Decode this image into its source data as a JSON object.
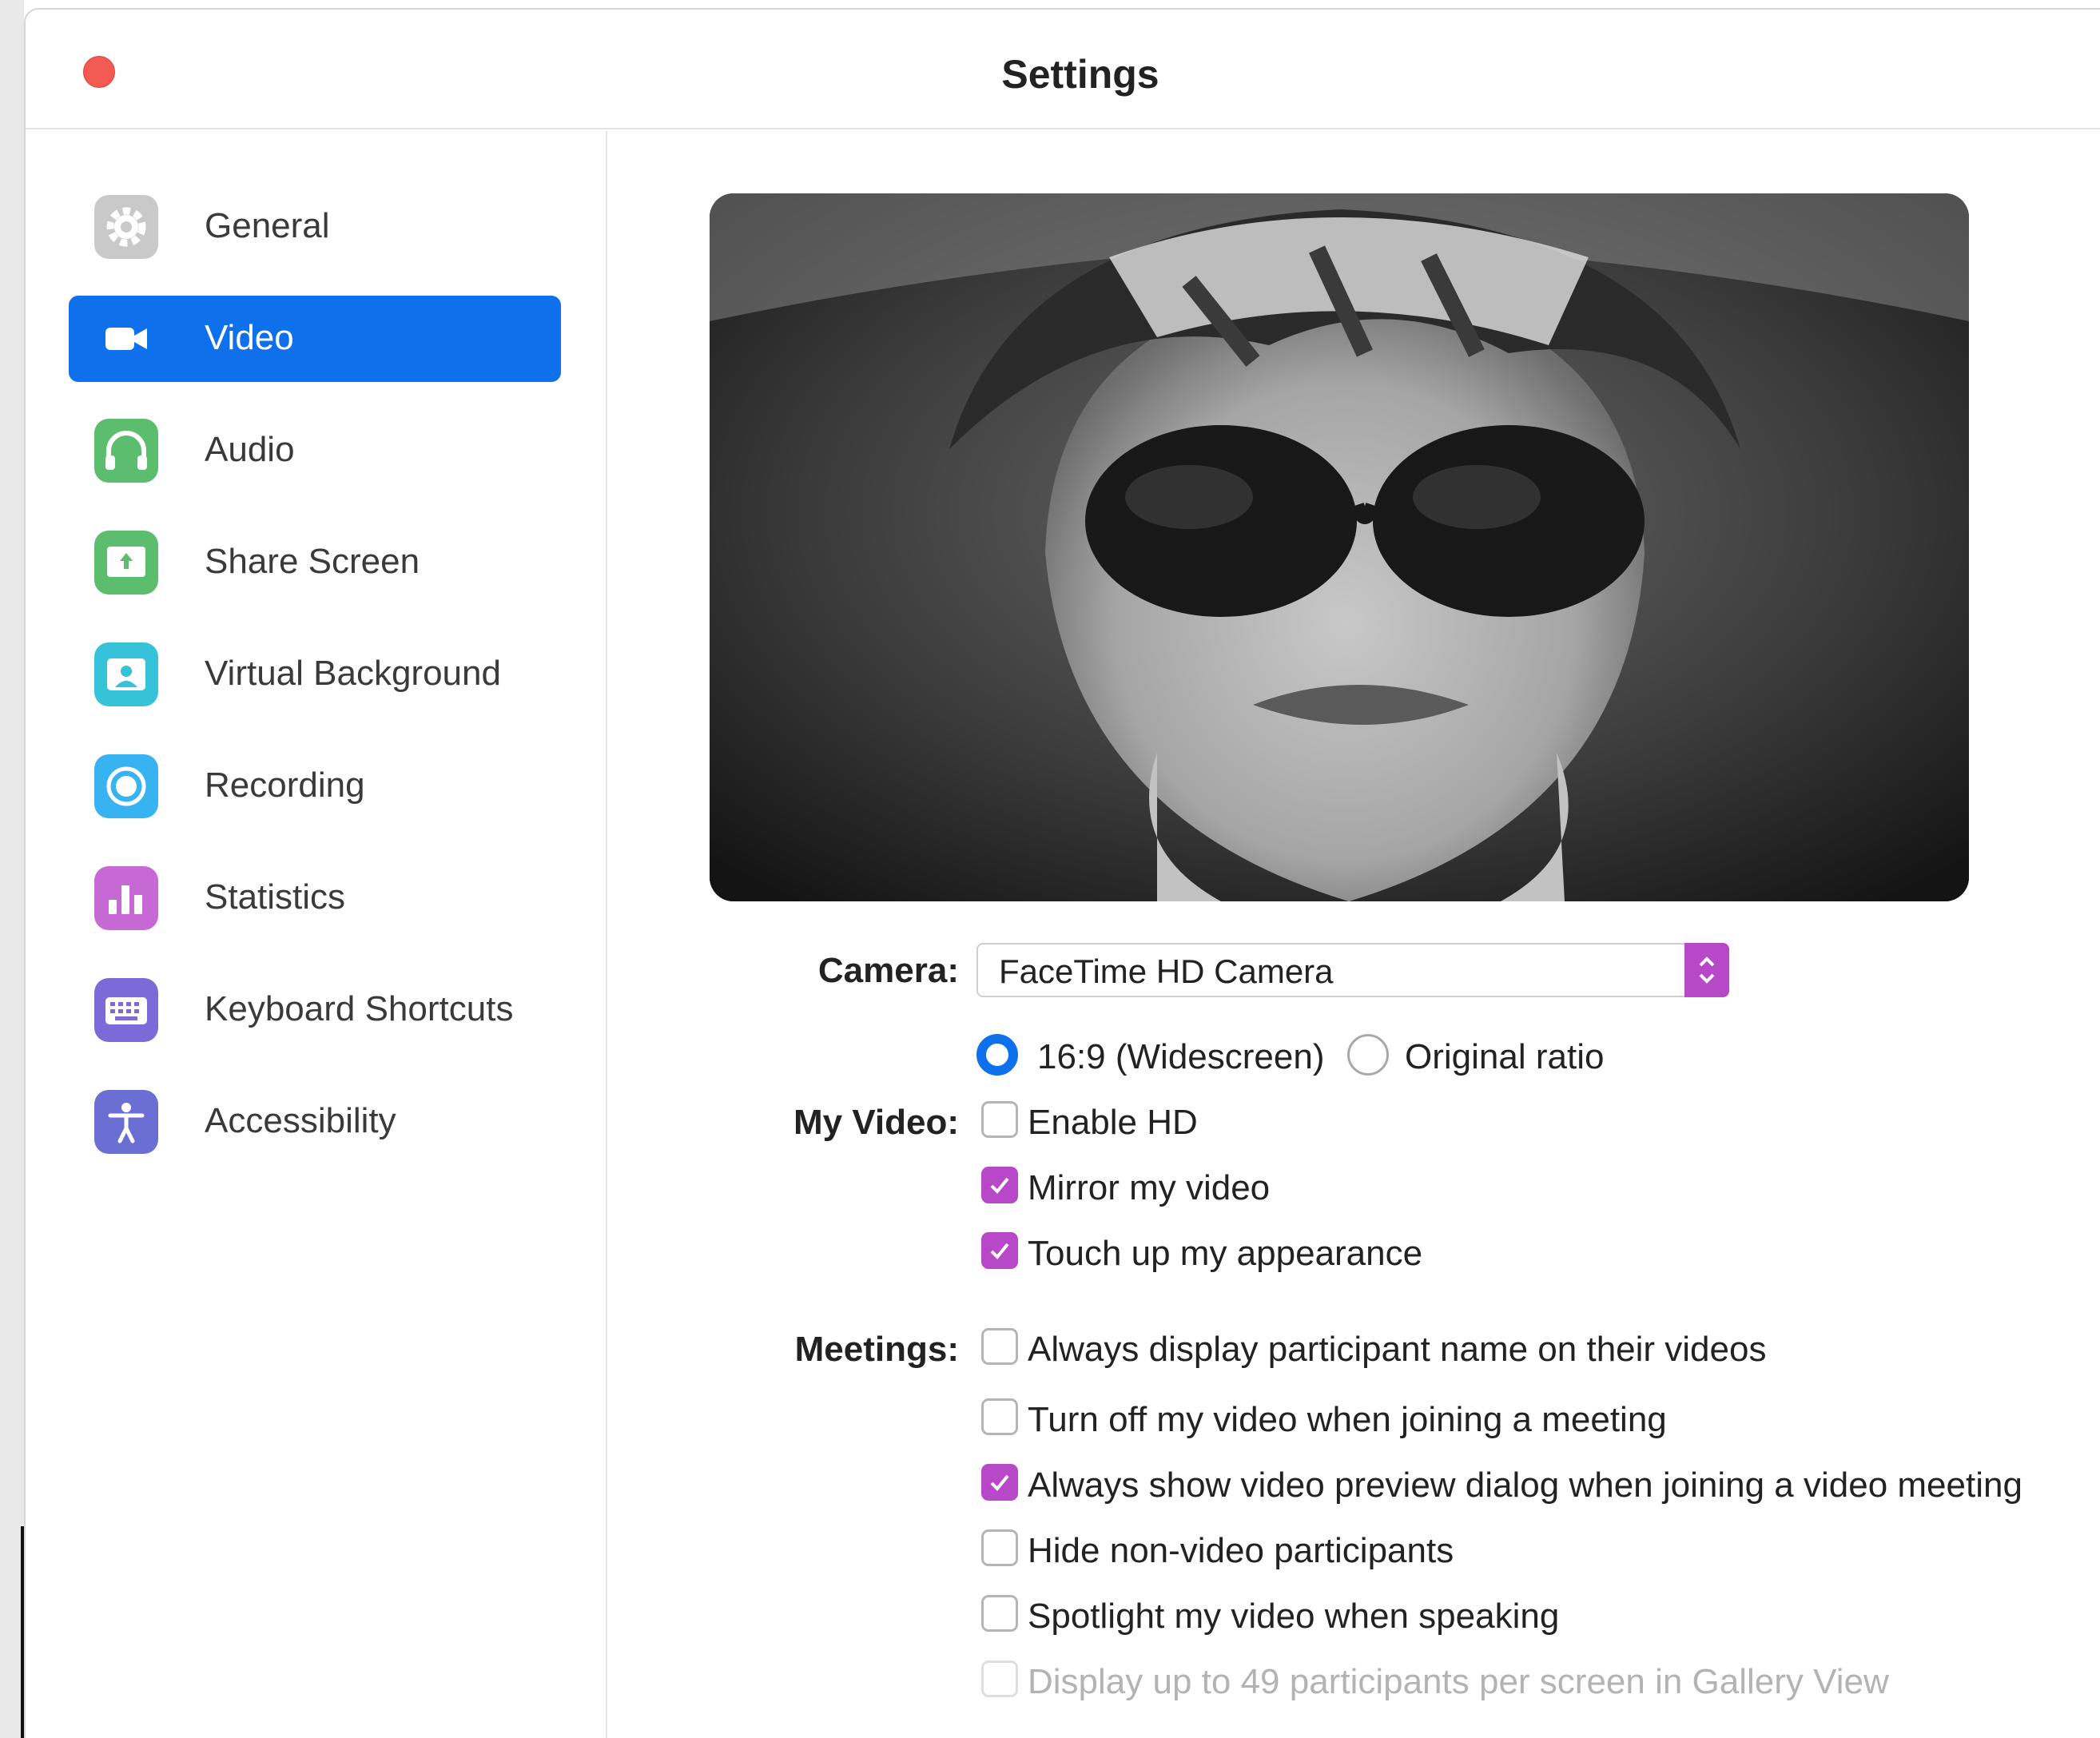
{
  "window": {
    "title": "Settings"
  },
  "sidebar": {
    "items": [
      {
        "label": "General",
        "icon": "gear-icon",
        "color": "#c9c9c9",
        "active": false
      },
      {
        "label": "Video",
        "icon": "video-camera-icon",
        "color": "#0e71eb",
        "active": true
      },
      {
        "label": "Audio",
        "icon": "headphones-icon",
        "color": "#5dbd6e",
        "active": false
      },
      {
        "label": "Share Screen",
        "icon": "share-screen-icon",
        "color": "#5dbd6e",
        "active": false
      },
      {
        "label": "Virtual Background",
        "icon": "person-frame-icon",
        "color": "#36c2d8",
        "active": false
      },
      {
        "label": "Recording",
        "icon": "record-icon",
        "color": "#38b3f2",
        "active": false
      },
      {
        "label": "Statistics",
        "icon": "bar-chart-icon",
        "color": "#c769d4",
        "active": false
      },
      {
        "label": "Keyboard Shortcuts",
        "icon": "keyboard-icon",
        "color": "#7b6ad8",
        "active": false
      },
      {
        "label": "Accessibility",
        "icon": "accessibility-icon",
        "color": "#6b6fd3",
        "active": false
      }
    ]
  },
  "video": {
    "camera_label": "Camera:",
    "camera_value": "FaceTime HD Camera",
    "ratio_options": [
      {
        "label": "16:9 (Widescreen)",
        "selected": true
      },
      {
        "label": "Original ratio",
        "selected": false
      }
    ],
    "my_video_label": "My Video:",
    "my_video_options": [
      {
        "label": "Enable HD",
        "checked": false
      },
      {
        "label": "Mirror my video",
        "checked": true
      },
      {
        "label": "Touch up my appearance",
        "checked": true
      }
    ],
    "meetings_label": "Meetings:",
    "meetings_options": [
      {
        "label": "Always display participant name on their videos",
        "checked": false
      },
      {
        "label": "Turn off my video when joining a meeting",
        "checked": false
      },
      {
        "label": "Always show video preview dialog when joining a video meeting",
        "checked": true
      },
      {
        "label": "Hide non-video participants",
        "checked": false
      },
      {
        "label": "Spotlight my video when speaking",
        "checked": false
      },
      {
        "label": "Display up to 49 participants per screen in Gallery View",
        "checked": false,
        "disabled": true
      }
    ]
  },
  "colors": {
    "accent": "#0e71eb",
    "checkbox": "#b748c8",
    "close": "#f25a52"
  }
}
